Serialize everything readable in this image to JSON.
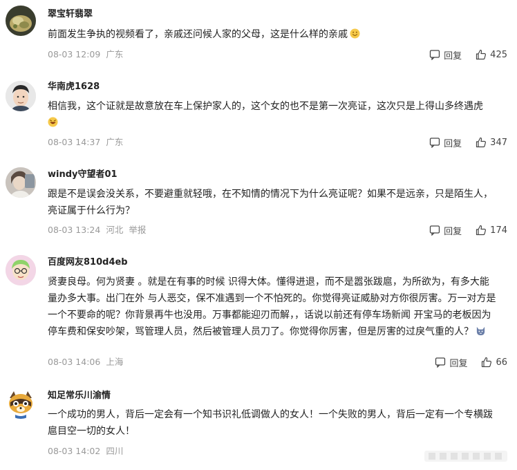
{
  "comments": [
    {
      "username": "翠宝轩翡翠",
      "content": "前面发生争执的视频看了，亲戚还问候人家的父母，这是什么样的亲戚",
      "emoji": "grin-emoji",
      "date": "08-03 12:09",
      "location": "广东",
      "report": "",
      "reply_label": "回复",
      "likes": "425",
      "avatar": "jade-stone-avatar"
    },
    {
      "username": "华南虎1628",
      "content": "相信我，这个证就是故意放在车上保护家人的，这个女的也不是第一次亮证，这次只是上得山多终遇虎",
      "emoji": "laugh-emoji",
      "date": "08-03 14:37",
      "location": "广东",
      "report": "",
      "reply_label": "回复",
      "likes": "347",
      "avatar": "cartoon-man-avatar"
    },
    {
      "username": "windy守望者01",
      "content": "跟是不是误会没关系，不要避重就轻哦，在不知情的情况下为什么亮证呢？如果不是远亲，只是陌生人，亮证属于什么行为？",
      "emoji": "",
      "date": "08-03 13:24",
      "location": "河北",
      "report": "举报",
      "reply_label": "回复",
      "likes": "174",
      "avatar": "photo-avatar"
    },
    {
      "username": "百度网友810d4eb",
      "content": "贤妻良母。何为贤妻 。就是在有事的时候 识得大体。懂得进退，而不是嚣张跋扈，为所欲为，有多大能量办多大事。出门在外 与人恶交，保不准遇到一个不怕死的。你觉得亮证威胁对方你很厉害。万一对方是一个不要命的呢？你背景再牛也没用。万事都能迎刃而解，，话说以前还有停车场新闻 开宝马的老板因为停车费和保安吵架，骂管理人员，然后被管理人员刀了。你觉得你厉害，但是厉害的过戾气重的人？",
      "emoji": "wolf-emoji",
      "date": "08-03 14:06",
      "location": "上海",
      "report": "",
      "reply_label": "回复",
      "likes": "66",
      "avatar": "cartoon-glasses-avatar"
    },
    {
      "username": "知足常乐川渝情",
      "content": "一个成功的男人，背后一定会有一个知书识礼低调做人的女人！一个失败的男人，背后一定有一个专横跋扈目空一切的女人！",
      "emoji": "",
      "date": "08-03 14:02",
      "location": "四川",
      "report": "",
      "reply_label": "",
      "likes": "",
      "avatar": "raccoon-avatar"
    }
  ],
  "colors": {
    "text": "#222222",
    "meta": "#999999",
    "action": "#444444"
  }
}
